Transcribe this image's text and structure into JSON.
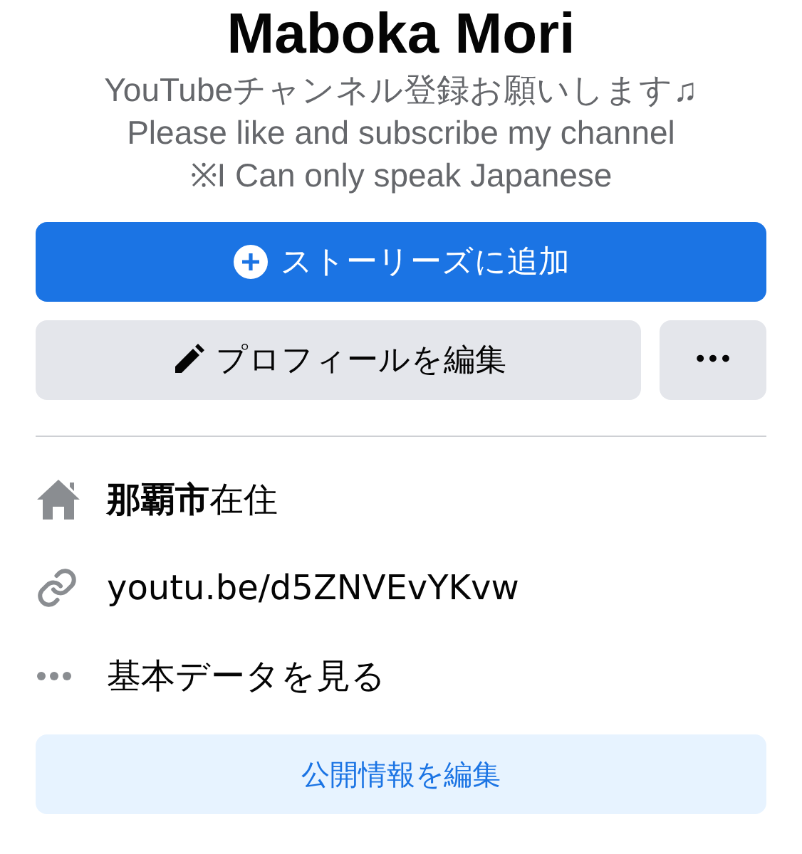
{
  "profile": {
    "name": "Maboka Mori",
    "bio": [
      "YouTubeチャンネル登録お願いします♫",
      "Please like and subscribe my channel",
      "※I Can only speak Japanese"
    ]
  },
  "add_story_button": {
    "label": "ストーリーズに追加"
  },
  "edit_profile_button": {
    "label": "プロフィールを編集"
  },
  "more_button": {
    "label": "•••"
  },
  "details": [
    {
      "kind": "home",
      "text": "**那覇市**在住"
    },
    {
      "kind": "link",
      "text": "youtu.be/d5ZNVEvYKvw"
    },
    {
      "kind": "more",
      "text": "基本データを見る"
    }
  ],
  "edit_public_button": {
    "label": "公開情報を編集"
  }
}
